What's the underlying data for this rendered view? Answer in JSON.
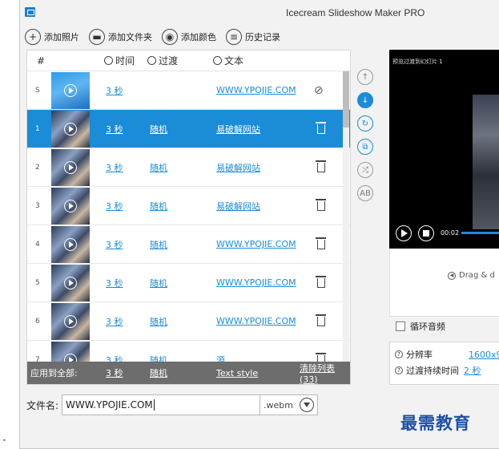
{
  "app": {
    "title": "Icecream Slideshow Maker PRO"
  },
  "toolbar": {
    "add_photos": "添加照片",
    "add_folder": "添加文件夹",
    "add_color": "添加颜色",
    "history": "历史记录"
  },
  "list": {
    "headers": {
      "num": "#",
      "time": "时间",
      "transition": "过渡",
      "text": "文本"
    },
    "rows": [
      {
        "num": "S",
        "time": "3 秒",
        "transition": "",
        "text": "WWW.YPOJIE.COM",
        "selected": false,
        "hidden": true
      },
      {
        "num": "1",
        "time": "3 秒",
        "transition": "随机",
        "text": "易破解网站",
        "selected": true
      },
      {
        "num": "2",
        "time": "3 秒",
        "transition": "随机",
        "text": "易破解网站",
        "selected": false
      },
      {
        "num": "3",
        "time": "3 秒",
        "transition": "随机",
        "text": "易破解网站",
        "selected": false
      },
      {
        "num": "4",
        "time": "3 秒",
        "transition": "随机",
        "text": "WWW.YPOJIE.COM",
        "selected": false
      },
      {
        "num": "5",
        "time": "3 秒",
        "transition": "随机",
        "text": "WWW.YPOJIE.COM",
        "selected": false
      },
      {
        "num": "6",
        "time": "3 秒",
        "transition": "随机",
        "text": "WWW.YPOJIE.COM",
        "selected": false
      },
      {
        "num": "7",
        "time": "3 秒",
        "transition": "随机",
        "text": "源",
        "selected": false
      }
    ],
    "apply_all": {
      "label": "应用到全部:",
      "time": "3 秒",
      "transition": "随机",
      "text_style": "Text style",
      "clear_list": "清除列表 (33)"
    }
  },
  "preview": {
    "label": "预览过渡到幻灯片 1",
    "time": "00:02",
    "drag_text": "Drag & d"
  },
  "loop_audio": {
    "label": "循环音频"
  },
  "settings": {
    "resolution_label": "分辨率",
    "resolution_value": "1600x9",
    "duration_label": "过渡持续时间",
    "duration_value": "2 秒"
  },
  "filename": {
    "label": "文件名:",
    "value": "WWW.YPOJIE.COM",
    "extension": ".webm"
  },
  "watermark": "最需教育",
  "colors": {
    "accent": "#1a8cd8",
    "apply_bar": "#6d6d6d"
  }
}
